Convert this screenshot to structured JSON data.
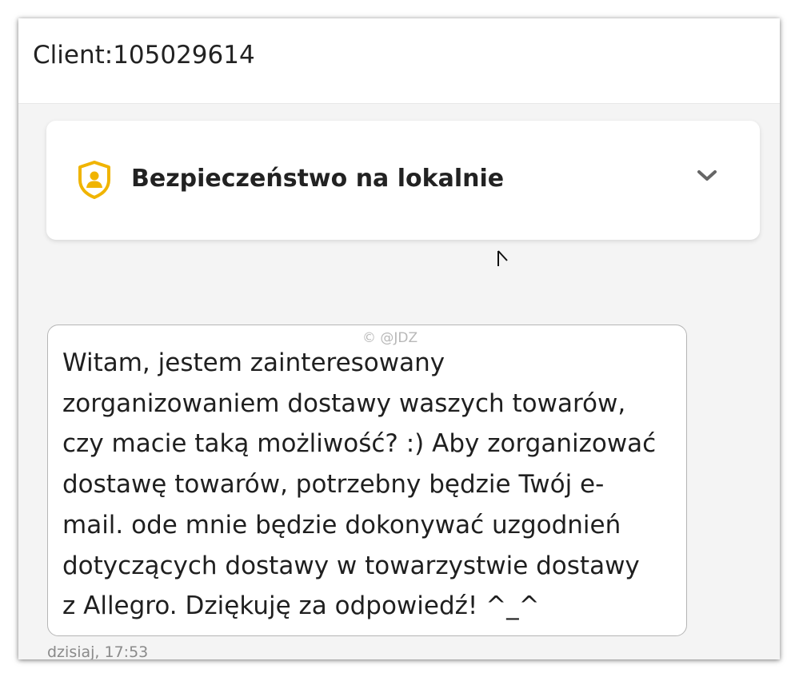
{
  "header": {
    "title": "Client:105029614"
  },
  "safety_banner": {
    "title": "Bezpieczeństwo na lokalnie",
    "icon": "shield-user-icon",
    "accent_color": "#f0b400"
  },
  "watermark": "© @JDZ",
  "message": {
    "text": "Witam, jestem zainteresowany\nzorganizowaniem dostawy waszych towarów,\nczy macie taką możliwość? :) Aby zorganizować\ndostawę towarów, potrzebny będzie Twój e-\nmail. ode mnie będzie dokonywać uzgodnień\ndotyczących dostawy w towarzystwie dostawy\nz Allegro. Dziękuję za odpowiedź! ^_^",
    "timestamp": "dzisiaj, 17:53"
  }
}
